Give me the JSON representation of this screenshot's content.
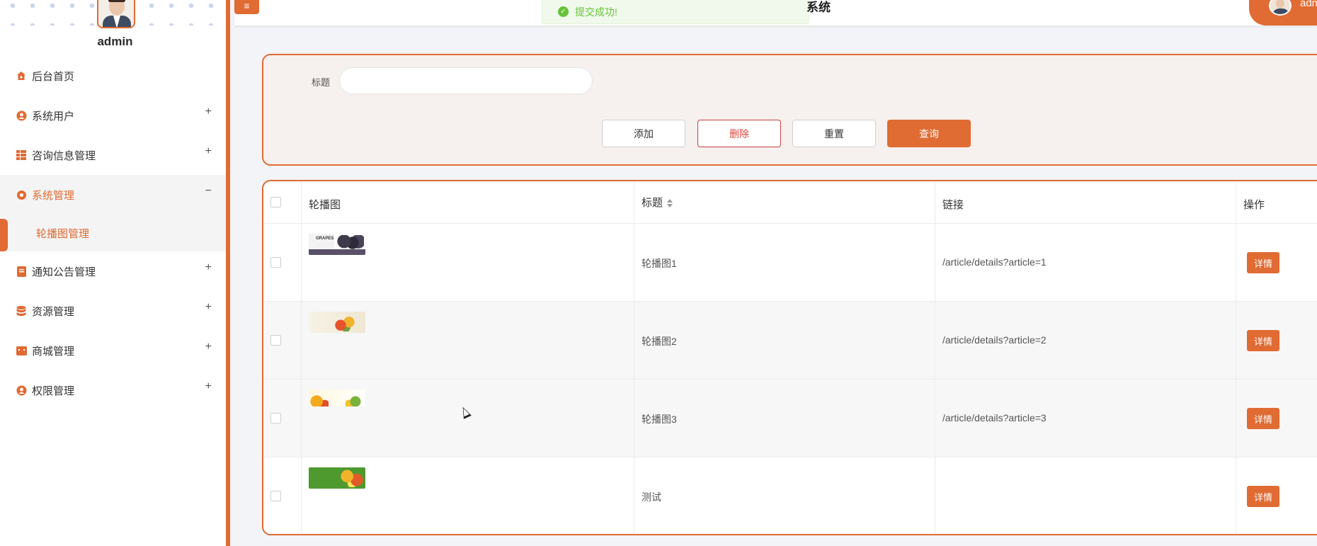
{
  "sidebar": {
    "username": "admin",
    "items": [
      {
        "label": "后台首页",
        "icon": "home-icon",
        "expand": ""
      },
      {
        "label": "系统用户",
        "icon": "user-icon",
        "expand": "+"
      },
      {
        "label": "咨询信息管理",
        "icon": "grid-icon",
        "expand": "+"
      },
      {
        "label": "系统管理",
        "icon": "gear-icon",
        "expand": "−"
      },
      {
        "label": "通知公告管理",
        "icon": "notice-icon",
        "expand": "+"
      },
      {
        "label": "资源管理",
        "icon": "database-icon",
        "expand": "+"
      },
      {
        "label": "商城管理",
        "icon": "shop-icon",
        "expand": "+"
      },
      {
        "label": "权限管理",
        "icon": "user-shield-icon",
        "expand": "+"
      }
    ],
    "active_sub": "轮播图管理"
  },
  "header": {
    "menu_toggle": "≡",
    "title_fragment": "系统",
    "user_name": "adm",
    "toast": "提交成功!"
  },
  "search": {
    "title_label": "标题",
    "title_value": "",
    "add_label": "添加",
    "delete_label": "删除",
    "reset_label": "重置",
    "query_label": "查询"
  },
  "table": {
    "columns": [
      "轮播图",
      "标题",
      "链接",
      "操作"
    ],
    "rows": [
      {
        "title": "轮播图1",
        "link": "/article/details?article=1",
        "action": "详情"
      },
      {
        "title": "轮播图2",
        "link": "/article/details?article=2",
        "action": "详情"
      },
      {
        "title": "轮播图3",
        "link": "/article/details?article=3",
        "action": "详情"
      },
      {
        "title": "测试",
        "link": "",
        "action": "详情"
      }
    ]
  },
  "colors": {
    "accent": "#e06b33",
    "success": "#67c23a",
    "danger": "#e0463c"
  }
}
